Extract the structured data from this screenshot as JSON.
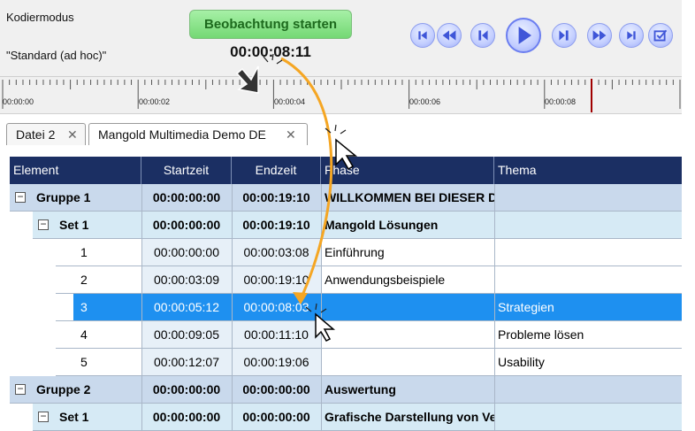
{
  "header": {
    "coding_mode_label": "Kodiermodus",
    "coding_mode_value": "\"Standard (ad hoc)\"",
    "start_button": "Beobachtung starten",
    "timecode": "00:00:08:11"
  },
  "transport": {
    "buttons": [
      "go-to-start-icon",
      "rewind-icon",
      "step-back-icon",
      "play-icon",
      "step-forward-icon",
      "fast-forward-icon",
      "go-to-end-icon",
      "checkbox-icon"
    ]
  },
  "timeline": {
    "tick_labels": [
      "00:00:00",
      "00:00:02",
      "00:00:04",
      "00:00:06",
      "00:00:08"
    ],
    "playhead_color": "#a00000"
  },
  "tabs": [
    {
      "label": "Datei 2"
    },
    {
      "label": "Mangold Multimedia Demo DE"
    }
  ],
  "grid": {
    "columns": [
      "Element",
      "Startzeit",
      "Endzeit",
      "Phase",
      "Thema"
    ],
    "rows": [
      {
        "kind": "group",
        "element": "Gruppe  1",
        "start": "00:00:00:00",
        "end": "00:00:19:10",
        "phase": "WILLKOMMEN BEI DIESER DEMO-DATEI",
        "thema": ""
      },
      {
        "kind": "set",
        "element": "Set  1",
        "start": "00:00:00:00",
        "end": "00:00:19:10",
        "phase": "Mangold Lösungen",
        "thema": ""
      },
      {
        "kind": "item",
        "element": "1",
        "start": "00:00:00:00",
        "end": "00:00:03:08",
        "phase": "Einführung",
        "thema": ""
      },
      {
        "kind": "item",
        "element": "2",
        "start": "00:00:03:09",
        "end": "00:00:19:10",
        "phase": "Anwendungsbeispiele",
        "thema": ""
      },
      {
        "kind": "selected",
        "element": "3",
        "start": "00:00:05:12",
        "end": "00:00:08:03",
        "phase": "",
        "thema": "Strategien"
      },
      {
        "kind": "item",
        "element": "4",
        "start": "00:00:09:05",
        "end": "00:00:11:10",
        "phase": "",
        "thema": "Probleme lösen"
      },
      {
        "kind": "item",
        "element": "5",
        "start": "00:00:12:07",
        "end": "00:00:19:06",
        "phase": "",
        "thema": "Usability"
      },
      {
        "kind": "group",
        "element": "Gruppe  2",
        "start": "00:00:00:00",
        "end": "00:00:00:00",
        "phase": "Auswertung",
        "thema": ""
      },
      {
        "kind": "set",
        "element": "Set  1",
        "start": "00:00:00:00",
        "end": "00:00:00:00",
        "phase": "Grafische Darstellung von Verhaltenscodes und Auswertungen",
        "thema": ""
      }
    ]
  },
  "colors": {
    "header_bg": "#1b2f63",
    "group_bg": "#c9d9ec",
    "set_bg": "#d6eaf5",
    "selected_bg": "#1e90f0",
    "start_button_bg": "#7ee07e",
    "annotation_arrow": "#f5a623"
  }
}
